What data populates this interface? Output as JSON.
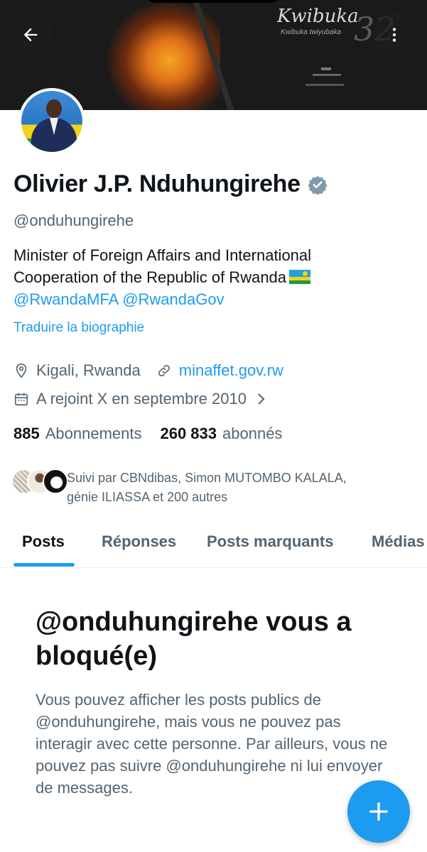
{
  "banner": {
    "title": "Kwibuka",
    "subtitle": "Kwibuka twiyubaka",
    "number": "32"
  },
  "header": {
    "back_icon": "arrow-left-icon",
    "more_icon": "more-vertical-icon"
  },
  "profile": {
    "name": "Olivier J.P. Nduhungirehe",
    "verified_icon": "verified-badge-icon",
    "handle": "@onduhungirehe",
    "bio_line1": "Minister of Foreign Affairs and International",
    "bio_line2": "Cooperation of the Republic of Rwanda",
    "bio_flag": "rwanda-flag-emoji",
    "bio_mentions": [
      "@RwandaMFA",
      "@RwandaGov"
    ],
    "translate_label": "Traduire la biographie",
    "location": "Kigali, Rwanda",
    "website": "minaffet.gov.rw",
    "joined": "A rejoint X en septembre 2010",
    "following_count": "885",
    "following_label": "Abonnements",
    "followers_count": "260 833",
    "followers_label": "abonnés",
    "followed_by_line1": "Suivi par CBNdibas, Simon MUTOMBO KALALA,",
    "followed_by_line2": "génie ILIASSA et 200 autres"
  },
  "tabs": [
    {
      "label": "Posts",
      "active": true
    },
    {
      "label": "Réponses",
      "active": false
    },
    {
      "label": "Posts marquants",
      "active": false
    },
    {
      "label": "Médias",
      "active": false
    }
  ],
  "blocked": {
    "title": "@onduhungirehe vous a bloqué(e)",
    "text": "Vous pouvez afficher les posts publics de @onduhungirehe, mais vous ne pouvez pas interagir avec cette personne. Par ailleurs, vous ne pouvez pas suivre @onduhungirehe ni lui envoyer de messages."
  },
  "fab": {
    "icon": "plus-icon"
  },
  "colors": {
    "accent": "#1d9bf0",
    "text_primary": "#0f1419",
    "text_secondary": "#536471"
  }
}
